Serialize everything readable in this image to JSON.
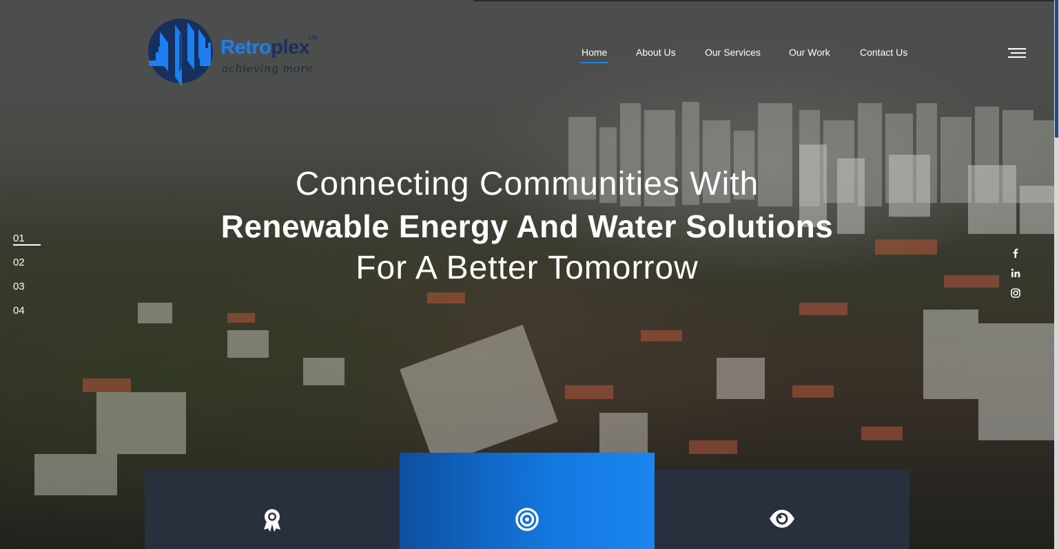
{
  "brand": {
    "name_part1": "Retro",
    "name_part2": "plex",
    "suffix": "LTD",
    "tagline": "achieving more",
    "logo_icon": "city-skyline-logo-icon",
    "accent_color": "#1d7ff0",
    "dark_color": "#16305e"
  },
  "nav": {
    "items": [
      {
        "label": "Home",
        "active": true
      },
      {
        "label": "About Us",
        "active": false
      },
      {
        "label": "Our Services",
        "active": false
      },
      {
        "label": "Our Work",
        "active": false
      },
      {
        "label": "Contact Us",
        "active": false
      }
    ],
    "menu_icon": "hamburger-menu-icon"
  },
  "hero": {
    "line1": "Connecting Communities With",
    "line2": "Renewable Energy And Water Solutions",
    "line3": "For A Better Tomorrow",
    "background": "aerial city photo"
  },
  "slides": {
    "items": [
      "01",
      "02",
      "03",
      "04"
    ],
    "active": "01"
  },
  "social": [
    "facebook-icon",
    "linkedin-icon",
    "instagram-icon"
  ],
  "features": [
    {
      "icon": "award-ribbon-icon",
      "color": "#27303c"
    },
    {
      "icon": "target-icon",
      "color": "#1378e0"
    },
    {
      "icon": "eye-icon",
      "color": "#27303c"
    }
  ]
}
